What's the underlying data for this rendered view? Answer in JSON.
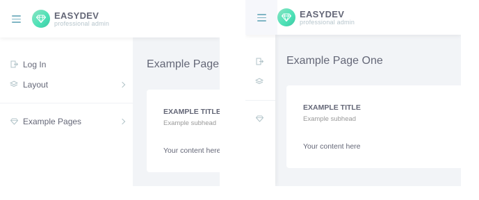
{
  "brand": {
    "name": "EASYDEV",
    "tagline": "professional admin",
    "accent": "#4ce1b6",
    "icon": "diamond-icon"
  },
  "sidebar": {
    "items": [
      {
        "label": "Log In",
        "icon": "log-in-icon",
        "has_submenu": false
      },
      {
        "label": "Layout",
        "icon": "layers-icon",
        "has_submenu": true
      },
      {
        "label": "Example Pages",
        "icon": "diamond-icon",
        "has_submenu": true
      }
    ]
  },
  "page": {
    "title": "Example Page One",
    "card": {
      "title": "EXAMPLE TITLE",
      "subhead": "Example subhead",
      "body": "Your content here"
    }
  },
  "colors": {
    "text": "#646777",
    "muted": "#999999",
    "background": "#f2f4f7",
    "icon": "#7fb5c4"
  }
}
